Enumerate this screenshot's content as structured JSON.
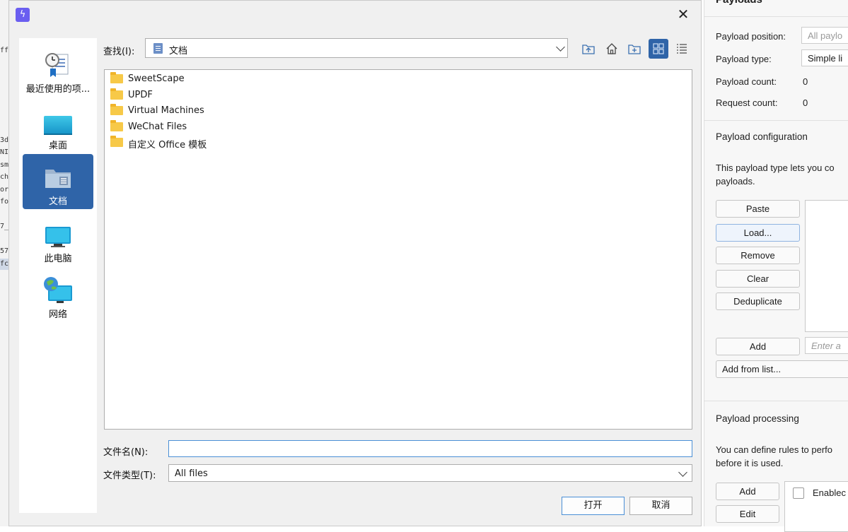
{
  "background_left": {
    "lines": [
      "ff",
      "3d",
      "NI",
      "sm",
      "ch",
      "or",
      "fo",
      "7_",
      "57",
      "fc"
    ]
  },
  "dialog": {
    "places": [
      {
        "label": "最近使用的项...",
        "icon": "recent-icon"
      },
      {
        "label": "桌面",
        "icon": "desktop-icon"
      },
      {
        "label": "文档",
        "icon": "documents-icon",
        "active": true
      },
      {
        "label": "此电脑",
        "icon": "this-pc-icon"
      },
      {
        "label": "网络",
        "icon": "network-icon"
      }
    ],
    "lookin_label": "查找(I):",
    "lookin_value": "文档",
    "files": [
      {
        "name": "SweetScape"
      },
      {
        "name": "UPDF"
      },
      {
        "name": "Virtual Machines"
      },
      {
        "name": "WeChat Files"
      },
      {
        "name": "自定义 Office 模板"
      }
    ],
    "filename_label": "文件名(N):",
    "filename_value": "",
    "filetype_label": "文件类型(T):",
    "filetype_value": "All files",
    "open_button": "打开",
    "cancel_button": "取消",
    "accent": "#2f64a8"
  },
  "right_panel": {
    "title": "Payloads",
    "payload_position_label": "Payload position:",
    "payload_position_value": "All paylo",
    "payload_type_label": "Payload type:",
    "payload_type_value": "Simple li",
    "payload_count_label": "Payload count:",
    "payload_count_value": "0",
    "request_count_label": "Request count:",
    "request_count_value": "0",
    "config_title": "Payload configuration",
    "config_desc_1": "This payload type lets you co",
    "config_desc_2": "payloads.",
    "buttons": [
      "Paste",
      "Load...",
      "Remove",
      "Clear",
      "Deduplicate"
    ],
    "add_button": "Add",
    "add_placeholder": "Enter a",
    "add_from_list": "Add from list...",
    "processing_title": "Payload processing",
    "processing_desc_1": "You can define rules to perfo",
    "processing_desc_2": "before it is used.",
    "proc_add": "Add",
    "proc_edit": "Edit",
    "enabled_header": "Enablec"
  }
}
